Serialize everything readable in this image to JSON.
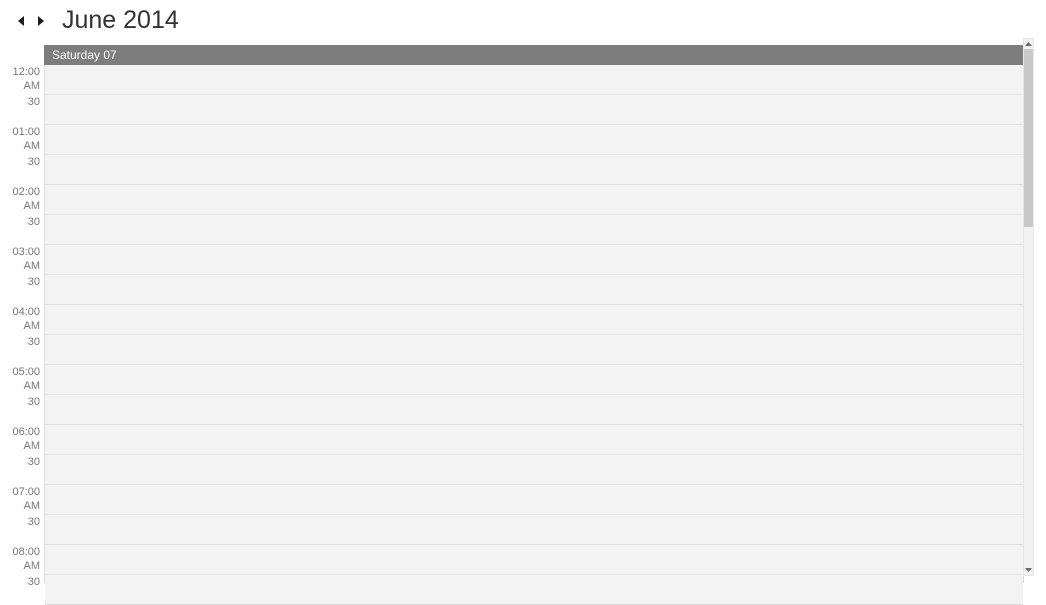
{
  "header": {
    "title": "June 2014"
  },
  "dayHeader": {
    "label": "Saturday 07"
  },
  "timeSlots": [
    {
      "label": "12:00 AM",
      "half": false
    },
    {
      "label": "30",
      "half": true
    },
    {
      "label": "01:00 AM",
      "half": false
    },
    {
      "label": "30",
      "half": true
    },
    {
      "label": "02:00 AM",
      "half": false
    },
    {
      "label": "30",
      "half": true
    },
    {
      "label": "03:00 AM",
      "half": false
    },
    {
      "label": "30",
      "half": true
    },
    {
      "label": "04:00 AM",
      "half": false
    },
    {
      "label": "30",
      "half": true
    },
    {
      "label": "05:00 AM",
      "half": false
    },
    {
      "label": "30",
      "half": true
    },
    {
      "label": "06:00 AM",
      "half": false
    },
    {
      "label": "30",
      "half": true
    },
    {
      "label": "07:00 AM",
      "half": false
    },
    {
      "label": "30",
      "half": true
    },
    {
      "label": "08:00 AM",
      "half": false
    },
    {
      "label": "30",
      "half": true
    }
  ]
}
